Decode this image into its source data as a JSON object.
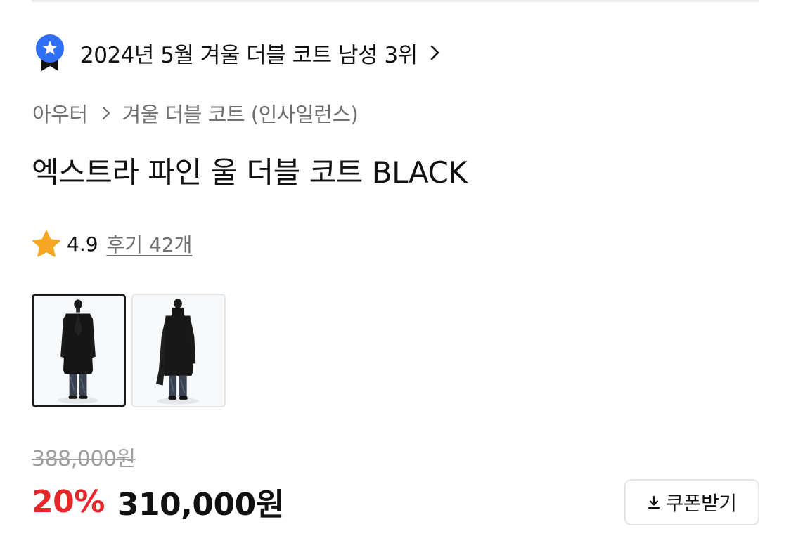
{
  "ranking": {
    "text": "2024년 5월 겨울 더블 코트 남성 3위",
    "badge_icon": "ranking-badge-star-icon",
    "badge_color": "#2f6ff5"
  },
  "breadcrumb": {
    "category": "아우터",
    "subcategory": "겨울 더블 코트 (인사일런스)"
  },
  "product": {
    "title": "엑스트라 파인 울 더블 코트 BLACK"
  },
  "rating": {
    "score": "4.9",
    "reviews_label": "후기 42개",
    "star_color": "#f5a623"
  },
  "gallery": {
    "selected_index": 0,
    "image_count": 2
  },
  "price": {
    "original": "388,000원",
    "discount": "20%",
    "sale": "310,000원",
    "discount_color": "#e8262a"
  },
  "coupon": {
    "label": "쿠폰받기",
    "icon": "download-icon"
  }
}
